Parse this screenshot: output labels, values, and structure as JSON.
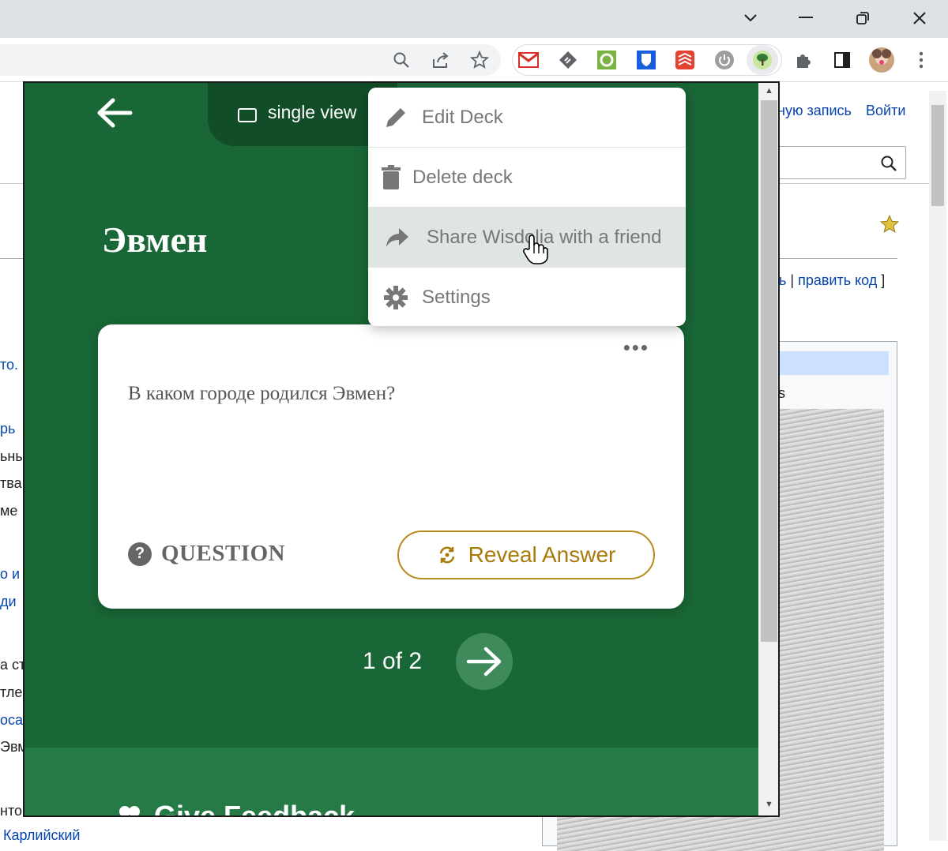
{
  "browser": {
    "window_controls": {
      "tabs_dropdown": "chevron-down-icon",
      "minimize": "minimize-icon",
      "restore": "restore-icon",
      "close": "close-icon"
    },
    "toolbar_icons": [
      "search-icon",
      "share-icon",
      "bookmark-star-icon"
    ],
    "extensions": [
      "gmail-icon",
      "feedly-icon",
      "refresh-ext-icon",
      "bitwarden-icon",
      "todoist-icon",
      "power-icon",
      "wisdolia-icon",
      "puzzle-extensions-icon"
    ],
    "side_panel_icon": "side-panel-icon",
    "menu_icon": "kebab-menu-icon"
  },
  "wiki": {
    "login_create": "ную запись",
    "login": "Войти",
    "edit_links": "ь | править код ]",
    "edit_link_part1": "ь",
    "edit_sep": " | ",
    "edit_link_part2": "править код",
    "edit_close": " ]",
    "infobox_caption": "s",
    "bottom_link": "Карлийский",
    "left_fragments": [
      "то. I",
      "рь",
      "ьны",
      "тва",
      "ме",
      "о и",
      "ди",
      "а ст",
      "тле",
      "оса",
      "Эвм",
      "нто"
    ]
  },
  "popup": {
    "view_mode": "single view",
    "deck_title": "Эвмен",
    "menu": {
      "items": [
        {
          "label": "Edit Deck",
          "icon": "pencil-icon"
        },
        {
          "label": "Delete deck",
          "icon": "trash-icon"
        },
        {
          "label": "Share Wisdolia with a friend",
          "icon": "share-arrow-icon"
        },
        {
          "label": "Settings",
          "icon": "gear-icon"
        }
      ],
      "hovered_index": 2
    },
    "card": {
      "more": "•••",
      "question": "В каком городе родился Эвмен?",
      "kind": "QUESTION",
      "reveal_label": "Reveal Answer"
    },
    "pager": "1 of 2",
    "feedback_label": "Give Feedback"
  }
}
